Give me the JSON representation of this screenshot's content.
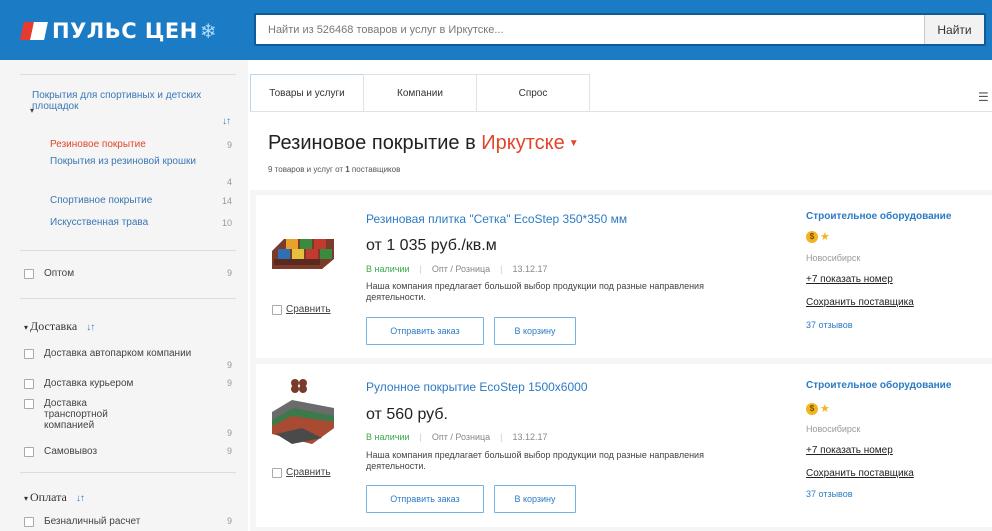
{
  "header": {
    "logo_text": "ПУЛЬС ЦЕН",
    "search_placeholder": "Найти из 526468 товаров и услуг в Иркутске...",
    "search_button": "Найти",
    "brand_color": "#1b7bc4"
  },
  "sidebar": {
    "category_parent": "Покрытия для спортивных и детских площадок",
    "categories": [
      {
        "label": "Резиновое покрытие",
        "count": "9",
        "active": true
      },
      {
        "label": "Покрытия из резиновой крошки",
        "count": "4",
        "active": false
      },
      {
        "label": "Спортивное покрытие",
        "count": "14",
        "active": false
      },
      {
        "label": "Искусственная трава",
        "count": "10",
        "active": false
      }
    ],
    "wholesale": {
      "label": "Оптом",
      "count": "9"
    },
    "delivery": {
      "title": "Доставка",
      "options": [
        {
          "label": "Доставка автопарком компании",
          "count": "9"
        },
        {
          "label": "Доставка курьером",
          "count": "9"
        },
        {
          "label": "Доставка транспортной компанией",
          "count": "9"
        },
        {
          "label": "Самовывоз",
          "count": "9"
        }
      ]
    },
    "payment": {
      "title": "Оплата",
      "options": [
        {
          "label": "Безналичный расчет",
          "count": "9"
        }
      ]
    }
  },
  "tabs": [
    {
      "label": "Товары и услуги",
      "active": true
    },
    {
      "label": "Компании",
      "active": false
    },
    {
      "label": "Спрос",
      "active": false
    }
  ],
  "main": {
    "title_prefix": "Резиновое покрытие в",
    "title_city": "Иркутске",
    "subtitle_pre": "9 товаров и услуг от ",
    "subtitle_bold": "1",
    "subtitle_post": " поставщиков",
    "accent_color": "#e2452a"
  },
  "products": [
    {
      "title": "Резиновая плитка \"Сетка\" EcoStep 350*350 мм",
      "price": "от 1 035 руб./кв.м",
      "stock": "В наличии",
      "trade": "Опт / Розница",
      "date": "13.12.17",
      "description": "Наша компания предлагает большой выбор продукции под разные направления деятельности.",
      "compare_label": "Сравнить",
      "order_button": "Отправить заказ",
      "cart_button": "В корзину",
      "seller": {
        "name": "Строительное оборудование",
        "coin": "$",
        "city": "Новосибирск",
        "phone": "+7 показать номер",
        "save": "Сохранить поставщика",
        "reviews": "37 отзывов"
      }
    },
    {
      "title": "Рулонное покрытие EcoStep 1500x6000",
      "price": "от 560 руб.",
      "stock": "В наличии",
      "trade": "Опт / Розница",
      "date": "13.12.17",
      "description": "Наша компания предлагает большой выбор продукции под разные направления деятельности.",
      "compare_label": "Сравнить",
      "order_button": "Отправить заказ",
      "cart_button": "В корзину",
      "seller": {
        "name": "Строительное оборудование",
        "coin": "$",
        "city": "Новосибирск",
        "phone": "+7 показать номер",
        "save": "Сохранить поставщика",
        "reviews": "37 отзывов"
      }
    }
  ]
}
